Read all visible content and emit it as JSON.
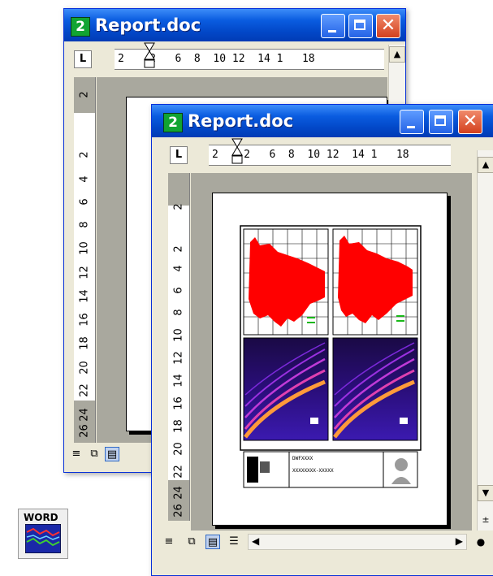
{
  "window_back": {
    "icon_label": "2",
    "title": "Report.doc",
    "ruler_text": "2    2   6  8  10 12  14 1   18",
    "tab_selector": "L",
    "vruler": [
      "2",
      "2",
      "4",
      "6",
      "8",
      "10",
      "12",
      "14",
      "16",
      "18",
      "20",
      "22",
      "24",
      "26"
    ]
  },
  "window_front": {
    "icon_label": "2",
    "title": "Report.doc",
    "ruler_text": "2    2   6  8  10 12  14 1   18",
    "tab_selector": "L",
    "vruler": [
      "2",
      "2",
      "4",
      "6",
      "8",
      "10",
      "12",
      "14",
      "16",
      "18",
      "20",
      "22",
      "24",
      "26"
    ]
  },
  "colors": {
    "titlebar": "#0a5ce0",
    "waveform": "#ff0000",
    "app_icon": "#11a432"
  },
  "document": {
    "footer_line1": "DWFXXXX",
    "footer_line2": "XXXXXXXX-XXXXX"
  },
  "desktop_icon": {
    "label": "WORD"
  }
}
